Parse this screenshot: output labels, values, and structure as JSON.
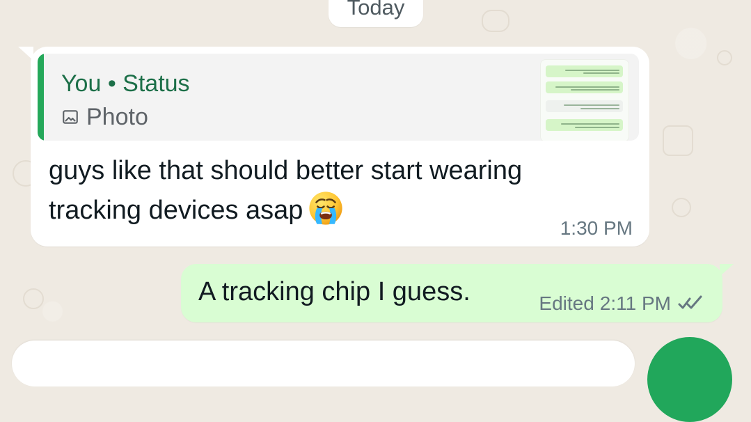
{
  "date_separator": {
    "label": "Today"
  },
  "incoming_message": {
    "reply_preview": {
      "author": "You • Status",
      "type_label": "Photo",
      "icon": "photo-icon"
    },
    "text": "guys like that  should better start wearing tracking devices asap",
    "emoji": "loudly-crying-face",
    "time": "1:30 PM"
  },
  "outgoing_message": {
    "text": "A tracking chip I guess.",
    "edited_label": "Edited",
    "time": "2:11 PM",
    "status_icon": "double-check-icon"
  },
  "colors": {
    "chat_background": "#efeae2",
    "incoming_bubble": "#ffffff",
    "outgoing_bubble": "#d9fdd3",
    "accent_green": "#21a75b",
    "quote_green": "#25a85a"
  }
}
